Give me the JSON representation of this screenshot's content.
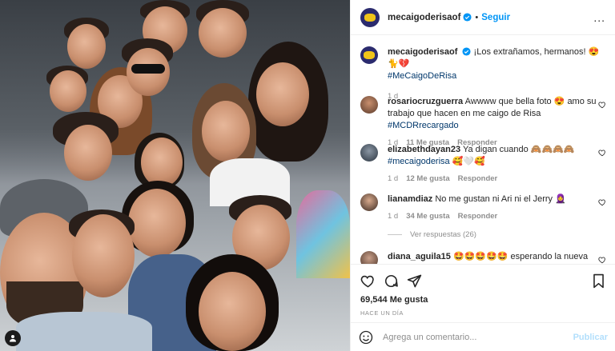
{
  "header": {
    "username": "mecaigoderisaof",
    "follow_label": "Seguir",
    "separator": "•",
    "more_label": "..."
  },
  "caption": {
    "username": "mecaigoderisaof",
    "text": "¡Los extrañamos, hermanos! 😍🐈💔",
    "hashtag": "#MeCaigoDeRisa",
    "time": "1 d"
  },
  "comments": [
    {
      "username": "rosariocruzguerra",
      "text": "Awwww que bella foto 😍 amo su trabajo que hacen en me caigo de Risa",
      "tag": "#MCDRrecargado",
      "time": "1 d",
      "likes": "11 Me gusta",
      "reply": "Responder"
    },
    {
      "username": "elizabethdayan23",
      "text": "Ya digan cuando 🙈🙈🙈🙈",
      "tag": "#mecaigoderisa",
      "text2": "🥰🤍🥰",
      "time": "1 d",
      "likes": "12 Me gusta",
      "reply": "Responder"
    },
    {
      "username": "lianamdiaz",
      "text": "No me gustan ni Ari ni el Jerry 🧕",
      "time": "1 d",
      "likes": "34 Me gusta",
      "reply": "Responder"
    },
    {
      "username": "diana_aguila15",
      "text": "🤩🤩🤩🤩🤩 esperando la nueva"
    }
  ],
  "view_replies": "Ver respuestas (26)",
  "likes_count": "69,544 Me gusta",
  "posted_when": "HACE UN DÍA",
  "add_comment": {
    "placeholder": "Agrega un comentario...",
    "post_label": "Publicar"
  },
  "colors": {
    "link": "#0095f6",
    "tag": "#00376b",
    "muted": "#8e8e8e",
    "post_disabled": "#b2dffc"
  },
  "icons": [
    "verified-badge-icon",
    "heart-icon",
    "comment-icon",
    "share-icon",
    "bookmark-icon",
    "emoji-icon",
    "user-icon"
  ]
}
